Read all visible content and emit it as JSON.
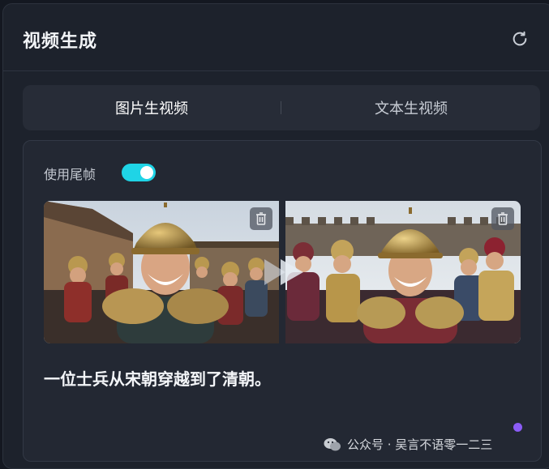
{
  "header": {
    "title": "视频生成",
    "refresh_icon": "refresh-icon"
  },
  "tabs": [
    {
      "label": "图片生视频",
      "active": true
    },
    {
      "label": "文本生视频",
      "active": false
    }
  ],
  "settings": {
    "end_frame_label": "使用尾帧",
    "end_frame_enabled": true
  },
  "frames": {
    "start": {
      "description": "smiling soldier in golden helmet in front of city wall"
    },
    "end": {
      "description": "soldiers in Qing-style helmets in front of the Great Wall"
    },
    "delete_icon": "trash-icon",
    "transition_icon": "play-arrows-icon"
  },
  "prompt": {
    "text": "一位士兵从宋朝穿越到了清朝。"
  },
  "watermark": {
    "text": "公众号 · 吴言不语零一二三"
  },
  "colors": {
    "background": "#1d222c",
    "card": "#232833",
    "tabs_bg": "#272c37",
    "toggle_on": "#1fd4e6",
    "accent_dot": "#8b5cf6"
  }
}
